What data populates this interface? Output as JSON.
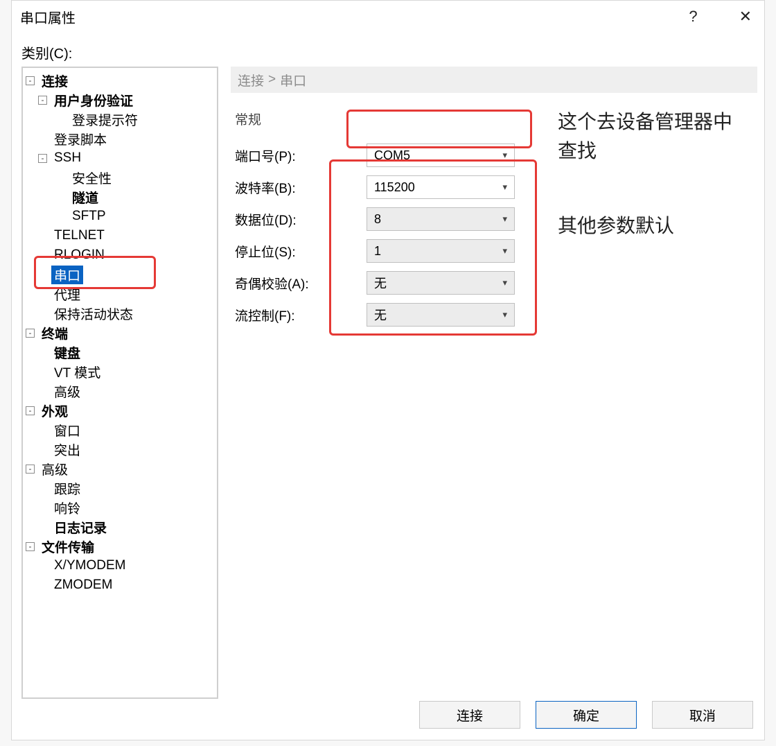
{
  "window": {
    "title": "串口属性",
    "help_tooltip": "?",
    "close_tooltip": "✕"
  },
  "tree_label": "类别(C):",
  "tree": {
    "items": [
      {
        "label": "连接",
        "level": 0,
        "expander": "-",
        "bold": true
      },
      {
        "label": "用户身份验证",
        "level": 1,
        "expander": "-",
        "bold": true
      },
      {
        "label": "登录提示符",
        "level": 2,
        "leaf": true
      },
      {
        "label": "登录脚本",
        "level": 1,
        "leaf": true
      },
      {
        "label": "SSH",
        "level": 1,
        "expander": "-"
      },
      {
        "label": "安全性",
        "level": 2,
        "leaf": true
      },
      {
        "label": "隧道",
        "level": 2,
        "leaf": true,
        "bold": true
      },
      {
        "label": "SFTP",
        "level": 2,
        "leaf": true
      },
      {
        "label": "TELNET",
        "level": 1,
        "leaf": true
      },
      {
        "label": "RLOGIN",
        "level": 1,
        "leaf": true
      },
      {
        "label": "串口",
        "level": 1,
        "leaf": true,
        "selected": true
      },
      {
        "label": "代理",
        "level": 1,
        "leaf": true
      },
      {
        "label": "保持活动状态",
        "level": 1,
        "leaf": true
      },
      {
        "label": "终端",
        "level": 0,
        "expander": "-",
        "bold": true
      },
      {
        "label": "键盘",
        "level": 1,
        "leaf": true,
        "bold": true
      },
      {
        "label": "VT 模式",
        "level": 1,
        "leaf": true
      },
      {
        "label": "高级",
        "level": 1,
        "leaf": true
      },
      {
        "label": "外观",
        "level": 0,
        "expander": "-",
        "bold": true
      },
      {
        "label": "窗口",
        "level": 1,
        "leaf": true
      },
      {
        "label": "突出",
        "level": 1,
        "leaf": true
      },
      {
        "label": "高级",
        "level": 0,
        "expander": "-"
      },
      {
        "label": "跟踪",
        "level": 1,
        "leaf": true
      },
      {
        "label": "响铃",
        "level": 1,
        "leaf": true
      },
      {
        "label": "日志记录",
        "level": 1,
        "leaf": true,
        "bold": true
      },
      {
        "label": "文件传输",
        "level": 0,
        "expander": "-",
        "bold": true
      },
      {
        "label": "X/YMODEM",
        "level": 1,
        "leaf": true
      },
      {
        "label": "ZMODEM",
        "level": 1,
        "leaf": true
      }
    ]
  },
  "breadcrumb": {
    "a": "连接",
    "sep": ">",
    "b": "串口"
  },
  "group": "常规",
  "form": {
    "port": {
      "label": "端口号(P):",
      "value": "COM5",
      "gray": false
    },
    "baud": {
      "label": "波特率(B):",
      "value": "115200",
      "gray": false
    },
    "data": {
      "label": "数据位(D):",
      "value": "8",
      "gray": true
    },
    "stop": {
      "label": "停止位(S):",
      "value": "1",
      "gray": true
    },
    "parity": {
      "label": "奇偶校验(A):",
      "value": "无",
      "gray": true
    },
    "flow": {
      "label": "流控制(F):",
      "value": "无",
      "gray": true
    }
  },
  "annotations": {
    "line1": "这个去设备管理器中查找",
    "line2": "其他参数默认"
  },
  "footer": {
    "connect": "连接",
    "ok": "确定",
    "cancel": "取消"
  }
}
